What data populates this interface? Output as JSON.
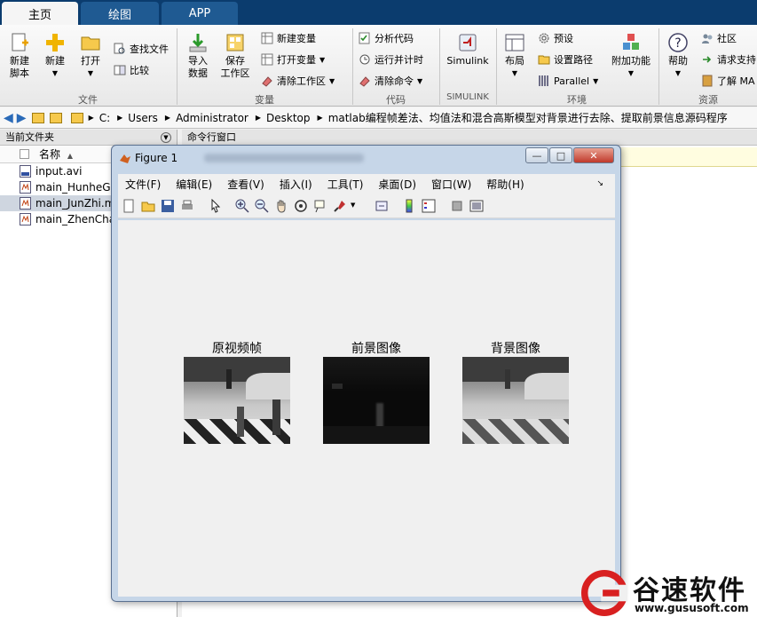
{
  "tabs": [
    "主页",
    "绘图",
    "APP"
  ],
  "ribbon": {
    "file": {
      "new_script": "新建\n脚本",
      "new": "新建",
      "open": "打开",
      "find_files": "查找文件",
      "compare": "比较",
      "group": "文件"
    },
    "variable": {
      "import": "导入\n数据",
      "save_workspace": "保存\n工作区",
      "new_variable": "新建变量",
      "open_variable": "打开变量",
      "clear_workspace": "清除工作区",
      "group": "变量"
    },
    "code": {
      "analyze": "分析代码",
      "run_time": "运行并计时",
      "clear_commands": "清除命令",
      "group": "代码"
    },
    "simulink": {
      "label": "Simulink",
      "group": "SIMULINK"
    },
    "env": {
      "layout": "布局",
      "preferences": "预设",
      "set_path": "设置路径",
      "parallel": "Parallel",
      "addons": "附加功能",
      "group": "环境"
    },
    "help": {
      "help": "帮助",
      "community": "社区",
      "request_support": "请求支持",
      "learn": "了解 MA",
      "group": "资源"
    }
  },
  "address": {
    "parts": [
      "C:",
      "Users",
      "Administrator",
      "Desktop",
      "matlab编程帧差法、均值法和混合高斯模型对背景进行去除、提取前景信息源码程序"
    ]
  },
  "left_panel": {
    "title": "当前文件夹",
    "col_name": "名称",
    "files": [
      "input.avi",
      "main_HunheGa",
      "main_JunZhi.m",
      "main_ZhenCha"
    ]
  },
  "right_panel": {
    "title": "命令行窗口"
  },
  "figure": {
    "title": "Figure 1",
    "menus": [
      "文件(F)",
      "编辑(E)",
      "查看(V)",
      "插入(I)",
      "工具(T)",
      "桌面(D)",
      "窗口(W)",
      "帮助(H)"
    ],
    "subplots": [
      "原视频帧",
      "前景图像",
      "背景图像"
    ]
  },
  "watermark": {
    "name": "谷速软件",
    "url": "www.gususoft.com"
  },
  "colors": {
    "tabbar": "#0b3c6e",
    "accent": "#1f5a92",
    "cmd_bg": "#fffde0"
  }
}
